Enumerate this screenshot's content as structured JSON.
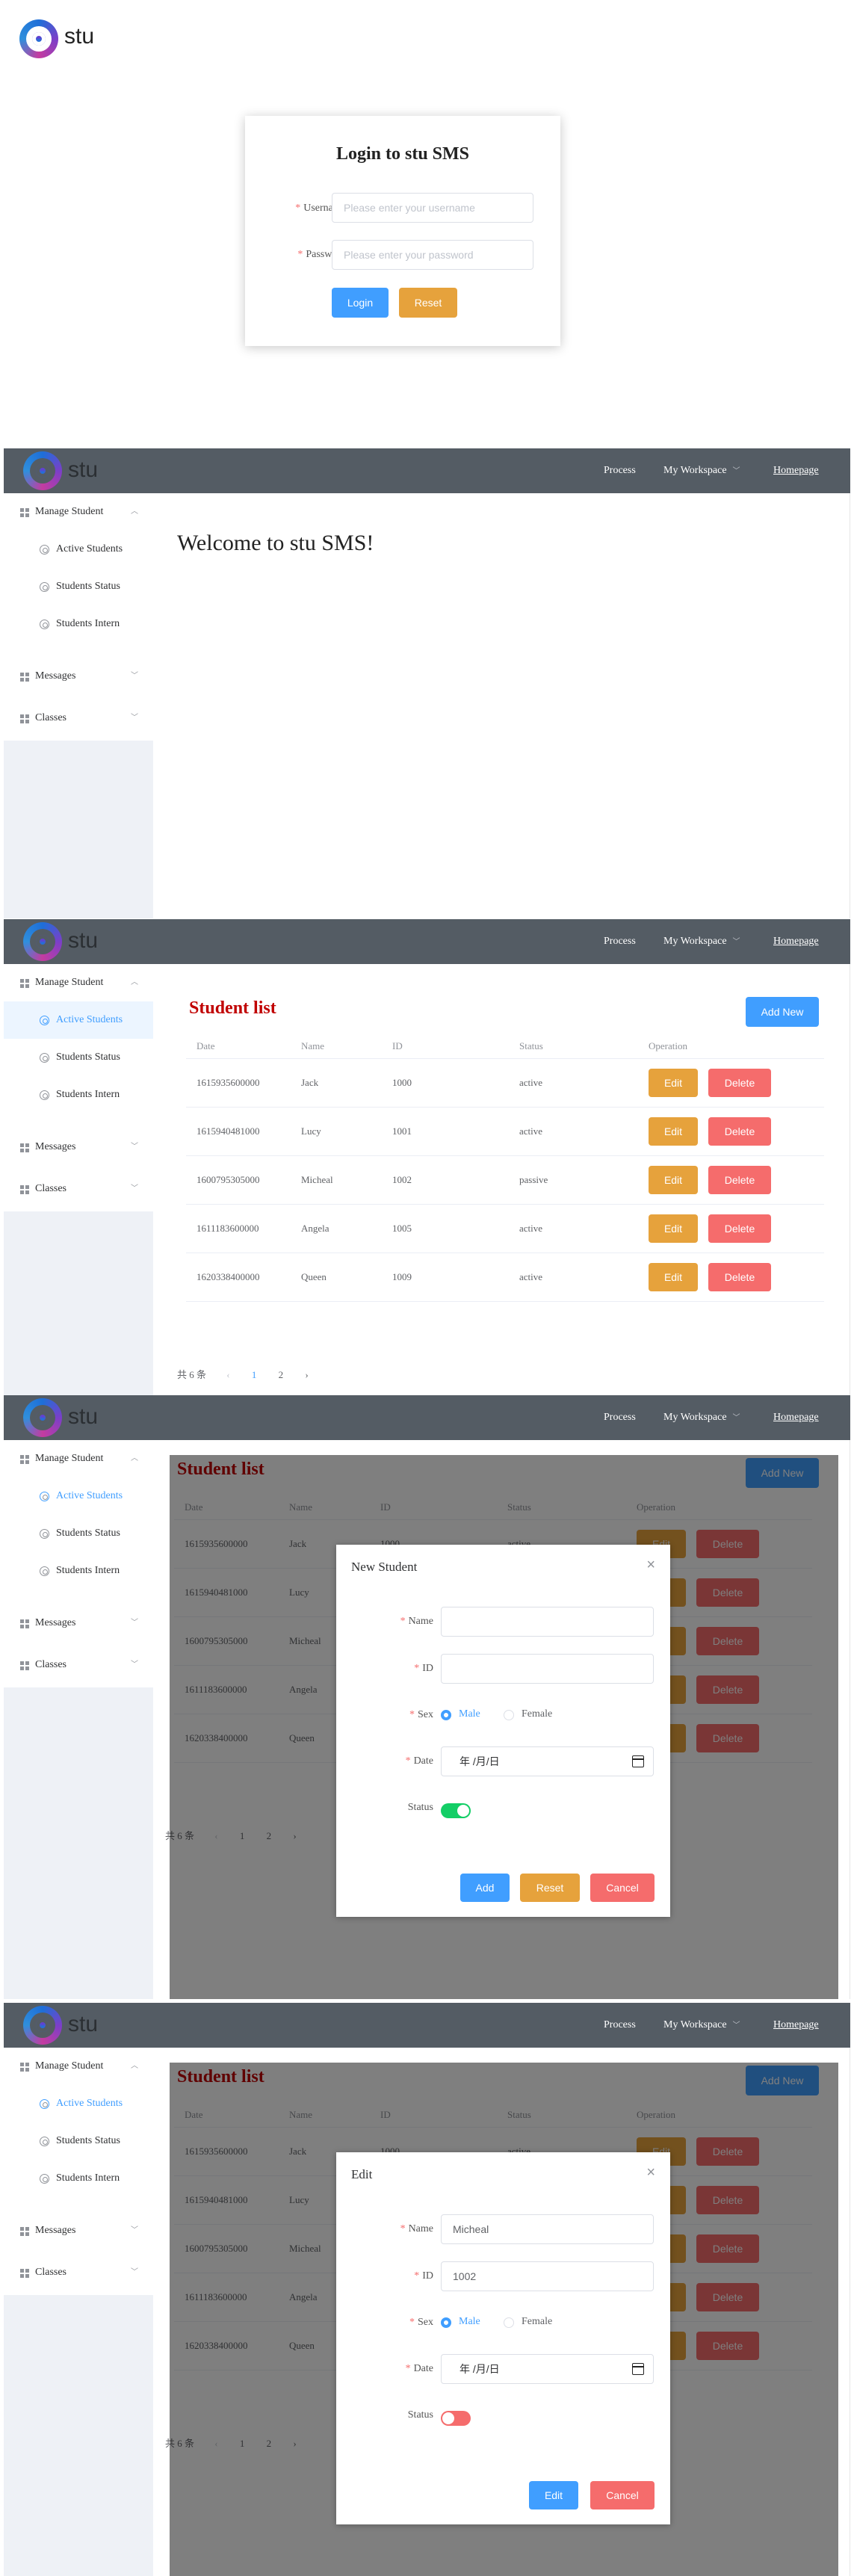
{
  "brand": {
    "name": "stu"
  },
  "login": {
    "title": "Login to stu SMS",
    "username_label": "Username",
    "username_placeholder": "Please enter your username",
    "password_label": "Password",
    "password_placeholder": "Please enter your password",
    "login_button": "Login",
    "reset_button": "Reset"
  },
  "header": {
    "process": "Process",
    "workspace": "My Workspace",
    "homepage": "Homepage"
  },
  "sidebar": {
    "manage_student": "Manage Student",
    "active_students": "Active Students",
    "students_status": "Students Status",
    "students_intern": "Students Intern",
    "messages": "Messages",
    "classes": "Classes"
  },
  "welcome": {
    "text": "Welcome to stu SMS!"
  },
  "student_list": {
    "title": "Student list",
    "add_button": "Add New",
    "columns": [
      "Date",
      "Name",
      "ID",
      "Status",
      "Operation"
    ],
    "rows": [
      {
        "date": "1615935600000",
        "name": "Jack",
        "id": "1000",
        "status": "active"
      },
      {
        "date": "1615940481000",
        "name": "Lucy",
        "id": "1001",
        "status": "active"
      },
      {
        "date": "1600795305000",
        "name": "Micheal",
        "id": "1002",
        "status": "passive"
      },
      {
        "date": "1611183600000",
        "name": "Angela",
        "id": "1005",
        "status": "active"
      },
      {
        "date": "1620338400000",
        "name": "Queen",
        "id": "1009",
        "status": "active"
      }
    ],
    "edit_label": "Edit",
    "delete_label": "Delete",
    "pagination": {
      "total": "共 6 条",
      "prev": "‹",
      "pages": [
        "1",
        "2"
      ],
      "next": "›",
      "current": "1"
    }
  },
  "new_dialog": {
    "title": "New Student",
    "name_label": "Name",
    "id_label": "ID",
    "sex_label": "Sex",
    "male": "Male",
    "female": "Female",
    "date_label": "Date",
    "date_placeholder": "年 /月/日",
    "status_label": "Status",
    "status_on": true,
    "add_button": "Add",
    "reset_button": "Reset",
    "cancel_button": "Cancel"
  },
  "edit_dialog": {
    "title": "Edit",
    "name_label": "Name",
    "name_value": "Micheal",
    "id_label": "ID",
    "id_value": "1002",
    "sex_label": "Sex",
    "male": "Male",
    "female": "Female",
    "date_label": "Date",
    "date_placeholder": "年 /月/日",
    "status_label": "Status",
    "status_on": false,
    "edit_button": "Edit",
    "cancel_button": "Cancel"
  },
  "colors": {
    "header": "#545c64",
    "primary": "#409eff",
    "warning": "#e6a23c",
    "danger": "#f56c6c",
    "success": "#13ce66",
    "title_red": "#c00000"
  }
}
